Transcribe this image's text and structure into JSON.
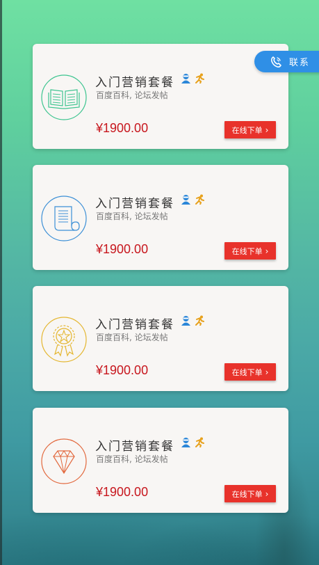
{
  "contact": {
    "label": "联系"
  },
  "packages": [
    {
      "title": "入门营销套餐",
      "subtitle": "百度百科, 论坛发帖",
      "price": "¥1900.00",
      "button": "在线下单",
      "icon": "book-icon",
      "color": "#3cc48f"
    },
    {
      "title": "入门营销套餐",
      "subtitle": "百度百科, 论坛发帖",
      "price": "¥1900.00",
      "button": "在线下单",
      "icon": "scroll-document-icon",
      "color": "#3b8fd6"
    },
    {
      "title": "入门营销套餐",
      "subtitle": "百度百科, 论坛发帖",
      "price": "¥1900.00",
      "button": "在线下单",
      "icon": "award-ribbon-icon",
      "color": "#e4b62f"
    },
    {
      "title": "入门营销套餐",
      "subtitle": "百度百科, 论坛发帖",
      "price": "¥1900.00",
      "button": "在线下单",
      "icon": "diamond-icon",
      "color": "#e2683d"
    }
  ],
  "colors": {
    "accent": "#e8322b",
    "price": "#c7161d",
    "contact": "#2f8fe6",
    "badge_user": "#2a86d8",
    "badge_runner": "#e7a11c"
  }
}
